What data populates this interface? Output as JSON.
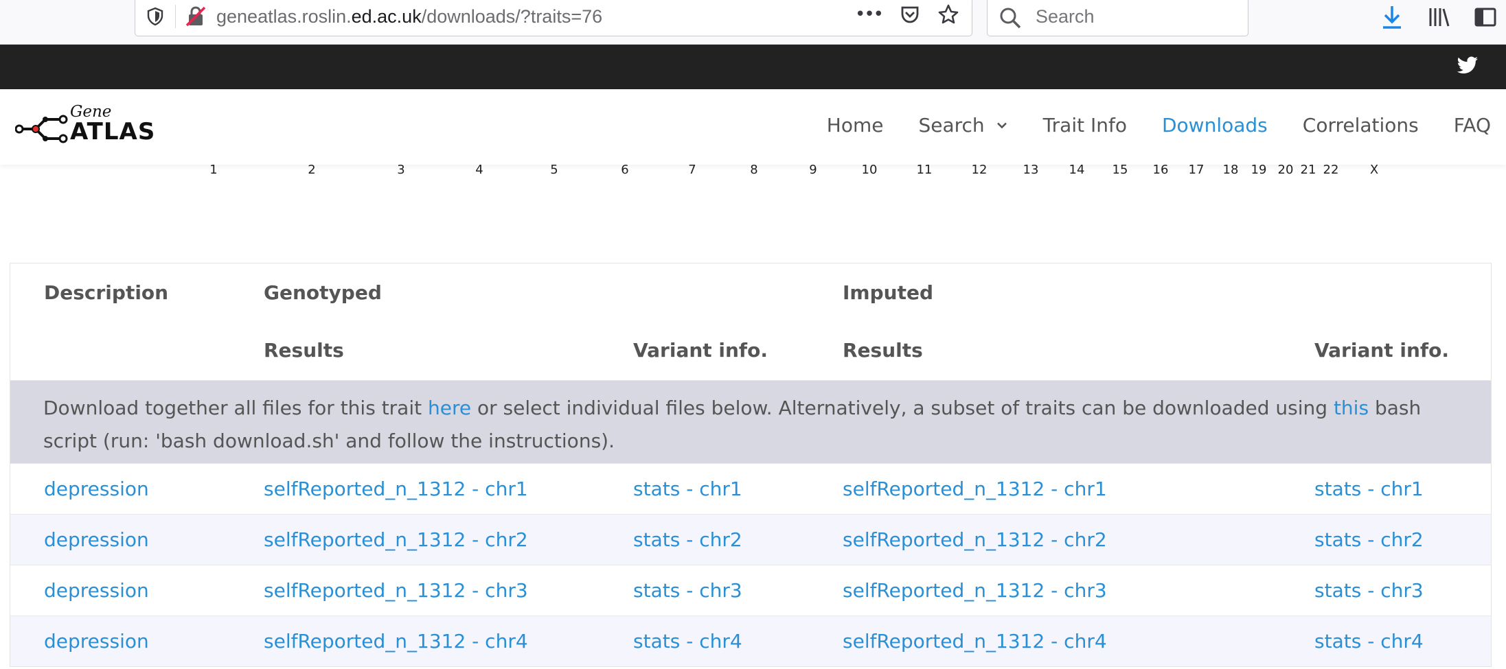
{
  "browser": {
    "url_prefix": "geneatlas.roslin.",
    "url_domain": "ed.ac.uk",
    "url_path": "/downloads/?traits=76",
    "search_placeholder": "Search",
    "overflow_label": "•••"
  },
  "site": {
    "logo_gene": "Gene",
    "logo_atlas": "ATLAS",
    "nav": [
      {
        "label": "Home"
      },
      {
        "label": "Search"
      },
      {
        "label": "Trait Info"
      },
      {
        "label": "Downloads"
      },
      {
        "label": "Correlations"
      },
      {
        "label": "FAQ"
      }
    ]
  },
  "chromosomes": [
    "1",
    "2",
    "3",
    "4",
    "5",
    "6",
    "7",
    "8",
    "9",
    "10",
    "11",
    "12",
    "13",
    "14",
    "15",
    "16",
    "17",
    "18",
    "19",
    "20",
    "21",
    "22",
    "X"
  ],
  "table": {
    "headers": {
      "description": "Description",
      "genotyped": "Genotyped",
      "imputed": "Imputed",
      "geno_results": "Results",
      "geno_variant": "Variant info.",
      "imp_results": "Results",
      "imp_variant": "Variant info."
    },
    "notice": {
      "part1": "Download together all files for this trait ",
      "link1": "here",
      "part2": " or select individual files below. Alternatively, a subset of traits can be downloaded using ",
      "link2": "this",
      "part3": " bash script (run: 'bash download.sh' and follow the instructions)."
    },
    "rows": [
      {
        "description": "depression",
        "geno_results": "selfReported_n_1312 - chr1",
        "geno_variant": "stats - chr1",
        "imp_results": "selfReported_n_1312 - chr1",
        "imp_variant": "stats - chr1"
      },
      {
        "description": "depression",
        "geno_results": "selfReported_n_1312 - chr2",
        "geno_variant": "stats - chr2",
        "imp_results": "selfReported_n_1312 - chr2",
        "imp_variant": "stats - chr2"
      },
      {
        "description": "depression",
        "geno_results": "selfReported_n_1312 - chr3",
        "geno_variant": "stats - chr3",
        "imp_results": "selfReported_n_1312 - chr3",
        "imp_variant": "stats - chr3"
      },
      {
        "description": "depression",
        "geno_results": "selfReported_n_1312 - chr4",
        "geno_variant": "stats - chr4",
        "imp_results": "selfReported_n_1312 - chr4",
        "imp_variant": "stats - chr4"
      }
    ]
  },
  "colors": {
    "link": "#2b8fd6",
    "active_nav": "#2b8fd6",
    "notice_bg": "#d7d8e1",
    "row_alt_bg": "#f4f5fd",
    "top_strip": "#222222",
    "download_arrow": "#1a86e8"
  }
}
